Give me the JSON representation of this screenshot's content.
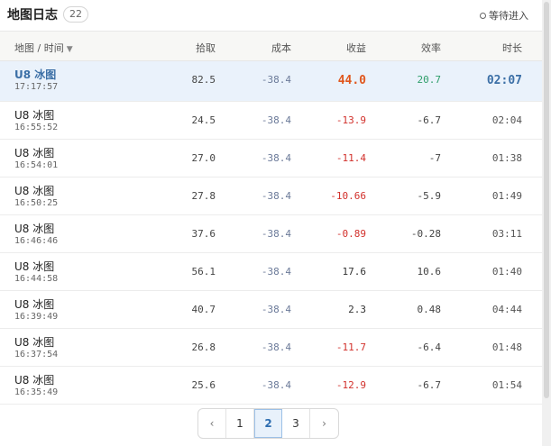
{
  "header": {
    "title": "地图日志",
    "count": "22",
    "waiting_label": "等待进入"
  },
  "columns": {
    "map_time": "地图 / 时间",
    "pick": "拾取",
    "cost": "成本",
    "gain": "收益",
    "efficiency": "效率",
    "duration": "时长"
  },
  "rows": [
    {
      "map": "U8 冰图",
      "time": "17:17:57",
      "pick": "82.5",
      "cost": "-38.4",
      "gain": "44.0",
      "eff": "20.7",
      "dur": "02:07",
      "gain_color": "#e0571e",
      "eff_color": "#2f9e6b"
    },
    {
      "map": "U8 冰图",
      "time": "16:55:52",
      "pick": "24.5",
      "cost": "-38.4",
      "gain": "-13.9",
      "eff": "-6.7",
      "dur": "02:04",
      "gain_color": "#d2312c",
      "eff_color": "#444444"
    },
    {
      "map": "U8 冰图",
      "time": "16:54:01",
      "pick": "27.0",
      "cost": "-38.4",
      "gain": "-11.4",
      "eff": "-7",
      "dur": "01:38",
      "gain_color": "#d2312c",
      "eff_color": "#444444"
    },
    {
      "map": "U8 冰图",
      "time": "16:50:25",
      "pick": "27.8",
      "cost": "-38.4",
      "gain": "-10.66",
      "eff": "-5.9",
      "dur": "01:49",
      "gain_color": "#d2312c",
      "eff_color": "#444444"
    },
    {
      "map": "U8 冰图",
      "time": "16:46:46",
      "pick": "37.6",
      "cost": "-38.4",
      "gain": "-0.89",
      "eff": "-0.28",
      "dur": "03:11",
      "gain_color": "#d2312c",
      "eff_color": "#444444"
    },
    {
      "map": "U8 冰图",
      "time": "16:44:58",
      "pick": "56.1",
      "cost": "-38.4",
      "gain": "17.6",
      "eff": "10.6",
      "dur": "01:40",
      "gain_color": "#333333",
      "eff_color": "#444444"
    },
    {
      "map": "U8 冰图",
      "time": "16:39:49",
      "pick": "40.7",
      "cost": "-38.4",
      "gain": "2.3",
      "eff": "0.48",
      "dur": "04:44",
      "gain_color": "#333333",
      "eff_color": "#444444"
    },
    {
      "map": "U8 冰图",
      "time": "16:37:54",
      "pick": "26.8",
      "cost": "-38.4",
      "gain": "-11.7",
      "eff": "-6.4",
      "dur": "01:48",
      "gain_color": "#d2312c",
      "eff_color": "#444444"
    },
    {
      "map": "U8 冰图",
      "time": "16:35:49",
      "pick": "25.6",
      "cost": "-38.4",
      "gain": "-12.9",
      "eff": "-6.7",
      "dur": "01:54",
      "gain_color": "#d2312c",
      "eff_color": "#444444"
    }
  ],
  "pagination": {
    "prev_icon": "chevron-left-icon",
    "next_icon": "chevron-right-icon",
    "pages": [
      "1",
      "2",
      "3"
    ],
    "current": "2"
  }
}
